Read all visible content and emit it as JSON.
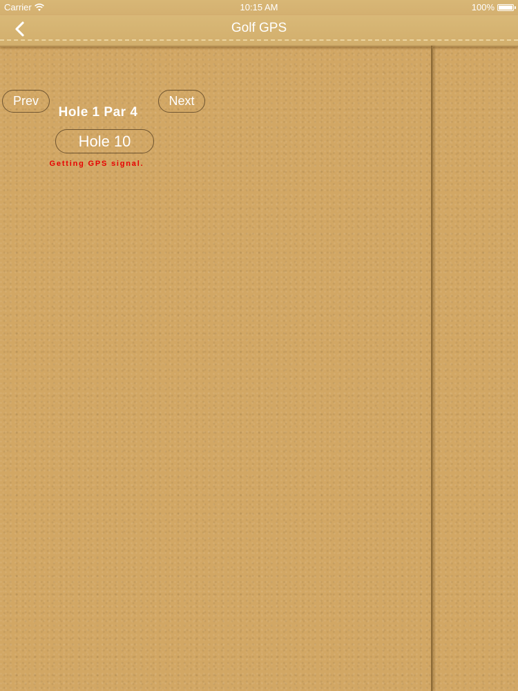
{
  "status_bar": {
    "carrier": "Carrier",
    "time": "10:15 AM",
    "battery": "100%",
    "battery_level": 1.0
  },
  "nav": {
    "title": "Golf GPS",
    "back_icon": "chevron-left-icon"
  },
  "hole": {
    "prev_label": "Prev",
    "next_label": "Next",
    "title": "Hole 1 Par 4",
    "selector_label": "Hole 10",
    "gps_status": "Getting GPS signal."
  },
  "colors": {
    "background": "#d2a764",
    "text": "#ffffff",
    "gps_status": "#e80000",
    "button_border": "#6e5430"
  }
}
